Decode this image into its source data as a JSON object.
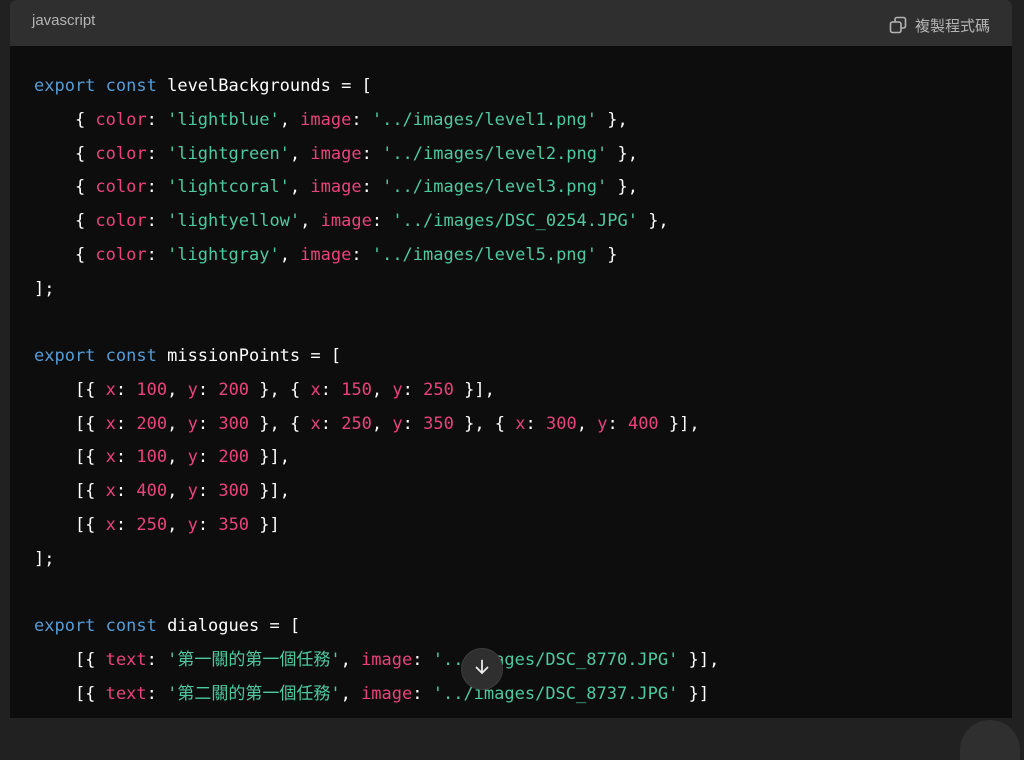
{
  "header": {
    "language": "javascript",
    "copy_label": "複製程式碼",
    "copy_icon": "copy-icon"
  },
  "code": {
    "lines": [
      [
        [
          "kw",
          "export"
        ],
        [
          "p",
          " "
        ],
        [
          "kw",
          "const"
        ],
        [
          "p",
          " levelBackgrounds = ["
        ]
      ],
      [
        [
          "p",
          "    { "
        ],
        [
          "prop",
          "color"
        ],
        [
          "p",
          ": "
        ],
        [
          "str",
          "'lightblue'"
        ],
        [
          "p",
          ", "
        ],
        [
          "prop",
          "image"
        ],
        [
          "p",
          ": "
        ],
        [
          "str",
          "'../images/level1.png'"
        ],
        [
          "p",
          " },"
        ]
      ],
      [
        [
          "p",
          "    { "
        ],
        [
          "prop",
          "color"
        ],
        [
          "p",
          ": "
        ],
        [
          "str",
          "'lightgreen'"
        ],
        [
          "p",
          ", "
        ],
        [
          "prop",
          "image"
        ],
        [
          "p",
          ": "
        ],
        [
          "str",
          "'../images/level2.png'"
        ],
        [
          "p",
          " },"
        ]
      ],
      [
        [
          "p",
          "    { "
        ],
        [
          "prop",
          "color"
        ],
        [
          "p",
          ": "
        ],
        [
          "str",
          "'lightcoral'"
        ],
        [
          "p",
          ", "
        ],
        [
          "prop",
          "image"
        ],
        [
          "p",
          ": "
        ],
        [
          "str",
          "'../images/level3.png'"
        ],
        [
          "p",
          " },"
        ]
      ],
      [
        [
          "p",
          "    { "
        ],
        [
          "prop",
          "color"
        ],
        [
          "p",
          ": "
        ],
        [
          "str",
          "'lightyellow'"
        ],
        [
          "p",
          ", "
        ],
        [
          "prop",
          "image"
        ],
        [
          "p",
          ": "
        ],
        [
          "str",
          "'../images/DSC_0254.JPG'"
        ],
        [
          "p",
          " },"
        ]
      ],
      [
        [
          "p",
          "    { "
        ],
        [
          "prop",
          "color"
        ],
        [
          "p",
          ": "
        ],
        [
          "str",
          "'lightgray'"
        ],
        [
          "p",
          ", "
        ],
        [
          "prop",
          "image"
        ],
        [
          "p",
          ": "
        ],
        [
          "str",
          "'../images/level5.png'"
        ],
        [
          "p",
          " }"
        ]
      ],
      [
        [
          "p",
          "];"
        ]
      ],
      [
        [
          "p",
          ""
        ]
      ],
      [
        [
          "kw",
          "export"
        ],
        [
          "p",
          " "
        ],
        [
          "kw",
          "const"
        ],
        [
          "p",
          " missionPoints = ["
        ]
      ],
      [
        [
          "p",
          "    [{ "
        ],
        [
          "prop",
          "x"
        ],
        [
          "p",
          ": "
        ],
        [
          "num",
          "100"
        ],
        [
          "p",
          ", "
        ],
        [
          "prop",
          "y"
        ],
        [
          "p",
          ": "
        ],
        [
          "num",
          "200"
        ],
        [
          "p",
          " }, { "
        ],
        [
          "prop",
          "x"
        ],
        [
          "p",
          ": "
        ],
        [
          "num",
          "150"
        ],
        [
          "p",
          ", "
        ],
        [
          "prop",
          "y"
        ],
        [
          "p",
          ": "
        ],
        [
          "num",
          "250"
        ],
        [
          "p",
          " }],"
        ]
      ],
      [
        [
          "p",
          "    [{ "
        ],
        [
          "prop",
          "x"
        ],
        [
          "p",
          ": "
        ],
        [
          "num",
          "200"
        ],
        [
          "p",
          ", "
        ],
        [
          "prop",
          "y"
        ],
        [
          "p",
          ": "
        ],
        [
          "num",
          "300"
        ],
        [
          "p",
          " }, { "
        ],
        [
          "prop",
          "x"
        ],
        [
          "p",
          ": "
        ],
        [
          "num",
          "250"
        ],
        [
          "p",
          ", "
        ],
        [
          "prop",
          "y"
        ],
        [
          "p",
          ": "
        ],
        [
          "num",
          "350"
        ],
        [
          "p",
          " }, { "
        ],
        [
          "prop",
          "x"
        ],
        [
          "p",
          ": "
        ],
        [
          "num",
          "300"
        ],
        [
          "p",
          ", "
        ],
        [
          "prop",
          "y"
        ],
        [
          "p",
          ": "
        ],
        [
          "num",
          "400"
        ],
        [
          "p",
          " }],"
        ]
      ],
      [
        [
          "p",
          "    [{ "
        ],
        [
          "prop",
          "x"
        ],
        [
          "p",
          ": "
        ],
        [
          "num",
          "100"
        ],
        [
          "p",
          ", "
        ],
        [
          "prop",
          "y"
        ],
        [
          "p",
          ": "
        ],
        [
          "num",
          "200"
        ],
        [
          "p",
          " }],"
        ]
      ],
      [
        [
          "p",
          "    [{ "
        ],
        [
          "prop",
          "x"
        ],
        [
          "p",
          ": "
        ],
        [
          "num",
          "400"
        ],
        [
          "p",
          ", "
        ],
        [
          "prop",
          "y"
        ],
        [
          "p",
          ": "
        ],
        [
          "num",
          "300"
        ],
        [
          "p",
          " }],"
        ]
      ],
      [
        [
          "p",
          "    [{ "
        ],
        [
          "prop",
          "x"
        ],
        [
          "p",
          ": "
        ],
        [
          "num",
          "250"
        ],
        [
          "p",
          ", "
        ],
        [
          "prop",
          "y"
        ],
        [
          "p",
          ": "
        ],
        [
          "num",
          "350"
        ],
        [
          "p",
          " }]"
        ]
      ],
      [
        [
          "p",
          "];"
        ]
      ],
      [
        [
          "p",
          ""
        ]
      ],
      [
        [
          "kw",
          "export"
        ],
        [
          "p",
          " "
        ],
        [
          "kw",
          "const"
        ],
        [
          "p",
          " dialogues = ["
        ]
      ],
      [
        [
          "p",
          "    [{ "
        ],
        [
          "prop",
          "text"
        ],
        [
          "p",
          ": "
        ],
        [
          "str",
          "'第一關的第一個任務'"
        ],
        [
          "p",
          ", "
        ],
        [
          "prop",
          "image"
        ],
        [
          "p",
          ": "
        ],
        [
          "str",
          "'../images/DSC_8770.JPG'"
        ],
        [
          "p",
          " }],"
        ]
      ],
      [
        [
          "p",
          "    [{ "
        ],
        [
          "prop",
          "text"
        ],
        [
          "p",
          ": "
        ],
        [
          "str",
          "'第二關的第一個任務'"
        ],
        [
          "p",
          ", "
        ],
        [
          "prop",
          "image"
        ],
        [
          "p",
          ": "
        ],
        [
          "str",
          "'../images/DSC_8737.JPG'"
        ],
        [
          "p",
          " }]"
        ]
      ]
    ]
  },
  "scroll_button": {
    "icon": "arrow-down-icon"
  },
  "colors": {
    "keyword": "#569cd6",
    "property": "#e9437a",
    "string": "#4ec9a0",
    "number": "#e9437a",
    "background": "#0d0d0d",
    "header": "#2f2f2f"
  }
}
